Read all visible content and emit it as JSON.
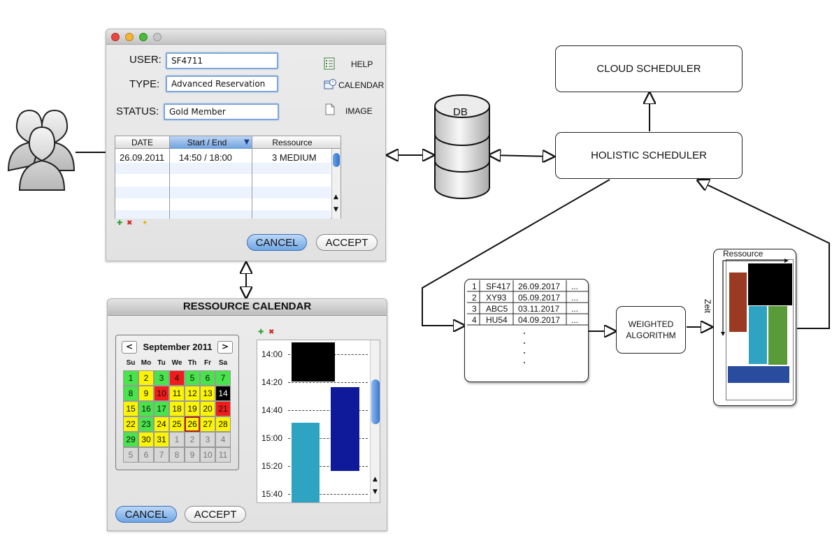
{
  "colors": {
    "cal_green": "#49e34b",
    "cal_yellow": "#fbf403",
    "cal_red": "#f21b1b",
    "cal_black": "#000000",
    "cal_gray": "#d7d7d7",
    "slot_black": "#000000",
    "slot_cyan": "#2ea4c2",
    "slot_navy": "#0f1a9a",
    "res_brown": "#9a3a22",
    "res_cyan": "#2ea4c2",
    "res_green": "#5a9a39",
    "res_blue": "#2a4c9e"
  },
  "users_icon": "users-icon",
  "form": {
    "user_label": "USER:",
    "user_value": "SF4711",
    "type_label": "TYPE:",
    "type_value": "Advanced Reservation",
    "status_label": "STATUS:",
    "status_value": "Gold Member",
    "side": [
      {
        "icon": "list-icon",
        "label": "HELP"
      },
      {
        "icon": "calendar-icon",
        "label": "CALENDAR"
      },
      {
        "icon": "document-icon",
        "label": "IMAGE"
      }
    ],
    "table": {
      "headers": [
        "DATE",
        "Start / End",
        "Ressource"
      ],
      "rows": [
        [
          "26.09.2011",
          "14:50 / 18:00",
          "3 MEDIUM"
        ]
      ]
    },
    "cancel": "CANCEL",
    "accept": "ACCEPT"
  },
  "calendar": {
    "title": "RESSOURCE CALENDAR",
    "month": "September 2011",
    "prev": "<",
    "next": ">",
    "dow": [
      "Su",
      "Mo",
      "Tu",
      "We",
      "Th",
      "Fr",
      "Sa"
    ],
    "weeks": [
      [
        [
          "1",
          "g"
        ],
        [
          "2",
          "y"
        ],
        [
          "3",
          "g"
        ],
        [
          "4",
          "r"
        ],
        [
          "5",
          "g"
        ],
        [
          "6",
          "g"
        ],
        [
          "7",
          "g"
        ]
      ],
      [
        [
          "8",
          "g"
        ],
        [
          "9",
          "y"
        ],
        [
          "10",
          "r"
        ],
        [
          "11",
          "y"
        ],
        [
          "12",
          "y"
        ],
        [
          "13",
          "y"
        ],
        [
          "14",
          "b"
        ]
      ],
      [
        [
          "15",
          "y"
        ],
        [
          "16",
          "g"
        ],
        [
          "17",
          "g"
        ],
        [
          "18",
          "y"
        ],
        [
          "19",
          "y"
        ],
        [
          "20",
          "y"
        ],
        [
          "21",
          "r"
        ]
      ],
      [
        [
          "22",
          "y"
        ],
        [
          "23",
          "g"
        ],
        [
          "24",
          "y"
        ],
        [
          "25",
          "y"
        ],
        [
          "26",
          "y"
        ],
        [
          "27",
          "y"
        ],
        [
          "28",
          "y"
        ]
      ],
      [
        [
          "29",
          "g"
        ],
        [
          "30",
          "y"
        ],
        [
          "31",
          "y"
        ],
        [
          "1",
          "x"
        ],
        [
          "2",
          "x"
        ],
        [
          "3",
          "x"
        ],
        [
          "4",
          "x"
        ]
      ],
      [
        [
          "5",
          "x"
        ],
        [
          "6",
          "x"
        ],
        [
          "7",
          "x"
        ],
        [
          "8",
          "x"
        ],
        [
          "9",
          "x"
        ],
        [
          "10",
          "x"
        ],
        [
          "11",
          "x"
        ]
      ]
    ],
    "selected_day": "26",
    "times": [
      "14:00",
      "14:20",
      "14:40",
      "15:00",
      "15:20",
      "15:40"
    ],
    "cancel": "CANCEL",
    "accept": "ACCEPT"
  },
  "db_label": "DB",
  "cloud_scheduler": "CLOUD SCHEDULER",
  "holistic_scheduler": "HOLISTIC SCHEDULER",
  "queue": {
    "rows": [
      [
        "1",
        "SF417",
        "26.09.2017",
        "..."
      ],
      [
        "2",
        "XY93",
        "05.09.2017",
        "..."
      ],
      [
        "3",
        "ABC5",
        "03.11.2017",
        "..."
      ],
      [
        "4",
        "HU54",
        "04.09.2017",
        "..."
      ]
    ]
  },
  "weighted": "WEIGHTED ALGORITHM",
  "resource_plot": {
    "x_label": "Ressource",
    "y_label": "Zeit"
  }
}
